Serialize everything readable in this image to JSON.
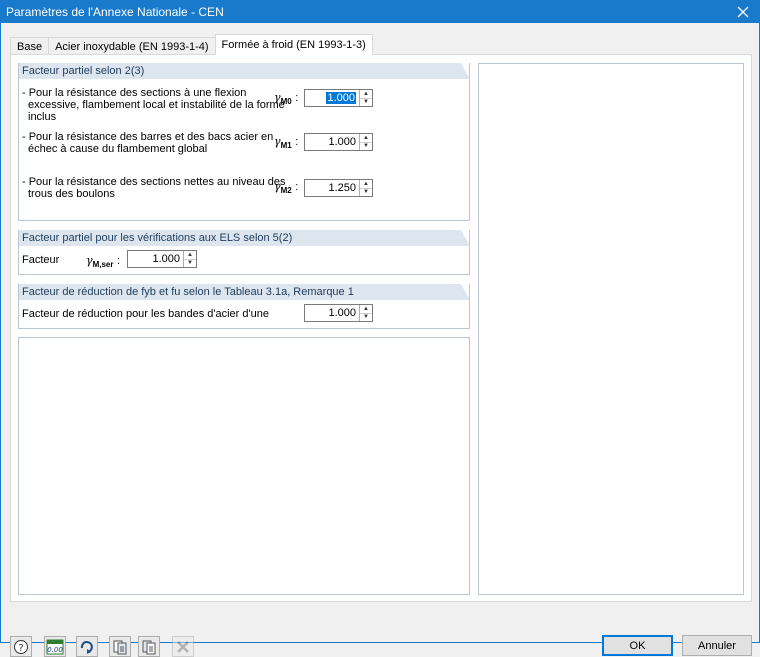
{
  "window": {
    "title": "Paramètres de l'Annexe Nationale - CEN"
  },
  "tabs": [
    {
      "label": "Base"
    },
    {
      "label": "Acier inoxydable (EN 1993-1-4)"
    },
    {
      "label": "Formée à froid (EN 1993-1-3)"
    }
  ],
  "group1": {
    "header": "Facteur partiel selon 2(3)",
    "rows": [
      {
        "line1": "- Pour la résistance des sections à une flexion",
        "line2": "excessive, flambement local et instabilité de la forme",
        "line3": "inclus",
        "gamma": "γ",
        "sub": "M0",
        "colon": ":",
        "value": "1.000"
      },
      {
        "line1": "- Pour la résistance des barres et des bacs acier en",
        "line2": "échec à cause du flambement global",
        "gamma": "γ",
        "sub": "M1",
        "colon": ":",
        "value": "1.000"
      },
      {
        "line1": "- Pour la résistance des sections nettes au niveau des",
        "line2": "trous des boulons",
        "gamma": "γ",
        "sub": "M2",
        "colon": ":",
        "value": "1.250"
      }
    ]
  },
  "group2": {
    "header": "Facteur partiel pour les vérifications aux ELS selon 5(2)",
    "label": "Facteur",
    "gamma": "γ",
    "sub": "M,ser",
    "colon": ":",
    "value": "1.000"
  },
  "group3": {
    "header": "Facteur de réduction de fyb et fu selon le Tableau 3.1a, Remarque 1",
    "label": "Facteur de réduction pour les bandes d'acier d'une",
    "value": "1.000"
  },
  "toolbar": {
    "icons": [
      "help-icon",
      "decimal-places-icon",
      "reset-icon",
      "copy-icon",
      "paste-icon",
      "delete-icon"
    ],
    "decimal_icon_text": "0.00"
  },
  "buttons": {
    "ok": "OK",
    "cancel": "Annuler"
  },
  "colors": {
    "titlebar": "#1979ca",
    "group_header": "#dde6ef",
    "selection": "#0078d7"
  }
}
